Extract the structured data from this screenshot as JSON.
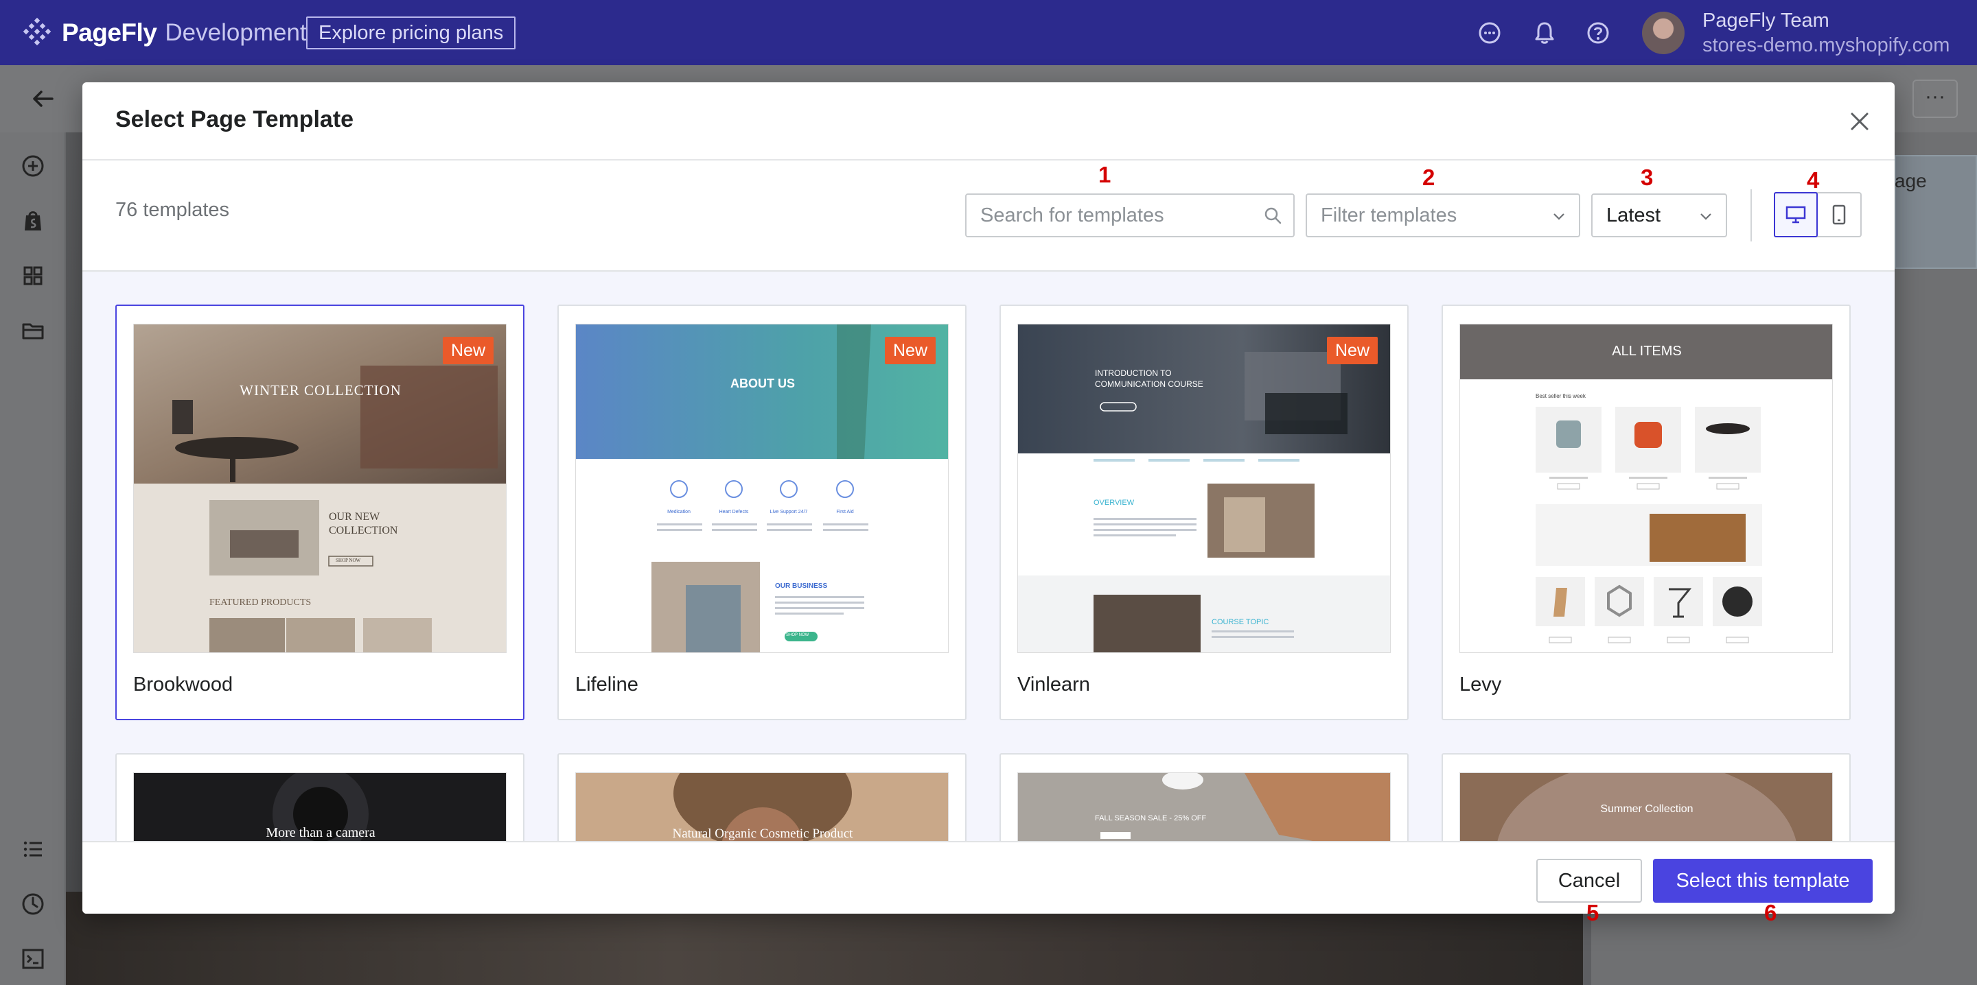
{
  "app": {
    "brand": "PageFly",
    "environment": "Development",
    "pricing_button": "Explore pricing plans",
    "account_name": "PageFly Team",
    "account_store": "stores-demo.myshopify.com"
  },
  "background": {
    "right_panel_text": "age",
    "more_label": "···"
  },
  "modal": {
    "title": "Select Page Template",
    "template_count": "76 templates",
    "search_placeholder": "Search for templates",
    "filter_placeholder": "Filter templates",
    "sort_value": "Latest",
    "view_modes": [
      "desktop",
      "mobile"
    ],
    "active_view": "desktop",
    "markers": [
      "1",
      "2",
      "3",
      "4",
      "5",
      "6"
    ],
    "cancel_label": "Cancel",
    "select_label": "Select this template"
  },
  "templates": [
    {
      "name": "Brookwood",
      "badge": "New",
      "selected": true,
      "hero_title": "WINTER COLLECTION",
      "section_title_1": "OUR NEW",
      "section_title_2": "COLLECTION",
      "section_button": "SHOP NOW",
      "featured_label": "FEATURED PRODUCTS"
    },
    {
      "name": "Lifeline",
      "badge": "New",
      "selected": false,
      "hero_title": "ABOUT US",
      "features": [
        "Medication",
        "Heart Defects",
        "Live Support 24/7",
        "First Aid"
      ],
      "business_title": "OUR BUSINESS",
      "business_button": "SHOP NOW"
    },
    {
      "name": "Vinlearn",
      "badge": "New",
      "selected": false,
      "hero_title_1": "INTRODUCTION TO",
      "hero_title_2": "COMMUNICATION COURSE",
      "overview_label": "OVERVIEW",
      "topic_label": "COURSE TOPIC"
    },
    {
      "name": "Levy",
      "badge": "",
      "selected": false,
      "hero_title": "ALL ITEMS",
      "bestseller_label": "Best seller this week"
    }
  ],
  "templates_row2": [
    {
      "hero_title": "More than a camera"
    },
    {
      "hero_title": "Natural Organic Cosmetic Product"
    },
    {
      "hero_title": "FALL SEASON SALE - 25% OFF"
    },
    {
      "hero_title": "Summer Collection"
    }
  ],
  "colors": {
    "topbar": "#2c2a8d",
    "primary": "#4a44e0",
    "badge": "#ea5a2a",
    "marker": "#d40000"
  }
}
